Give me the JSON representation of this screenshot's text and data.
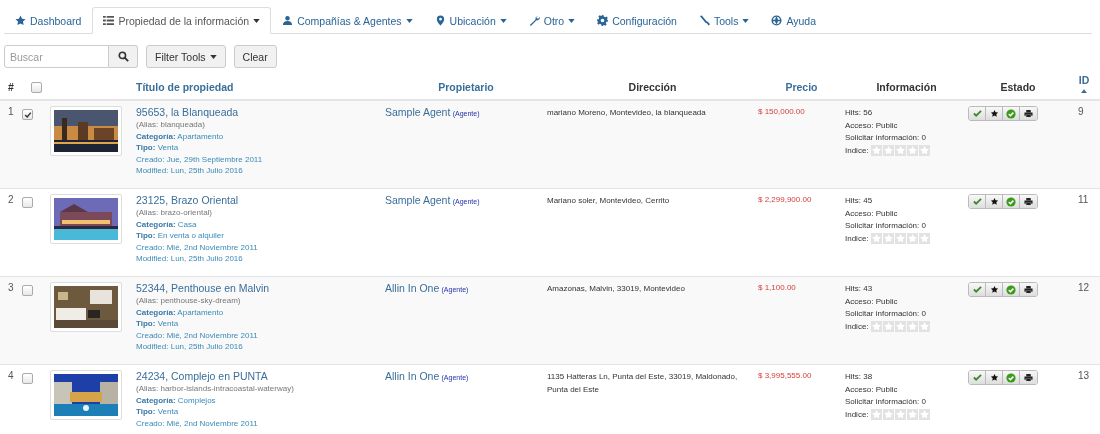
{
  "tabs": [
    {
      "label": "Dashboard",
      "dropdown": false,
      "selected": false
    },
    {
      "label": "Propiedad de la información",
      "dropdown": true,
      "selected": true
    },
    {
      "label": "Compañías & Agentes",
      "dropdown": true,
      "selected": false
    },
    {
      "label": "Ubicación",
      "dropdown": true,
      "selected": false
    },
    {
      "label": "Otro",
      "dropdown": true,
      "selected": false
    },
    {
      "label": "Configuración",
      "dropdown": false,
      "selected": false
    },
    {
      "label": "Tools",
      "dropdown": true,
      "selected": false
    },
    {
      "label": "Ayuda",
      "dropdown": false,
      "selected": false
    }
  ],
  "search": {
    "placeholder": "Buscar"
  },
  "toolbar": {
    "filter": "Filter Tools",
    "clear": "Clear"
  },
  "table": {
    "select_all": {
      "checked": false
    },
    "columns": [
      {
        "label": "#",
        "sortable": false,
        "sorted": false
      },
      {
        "label": "Título de propiedad",
        "sortable": true,
        "sorted": false
      },
      {
        "label": "Propietario",
        "sortable": true,
        "sorted": false
      },
      {
        "label": "Dirección",
        "sortable": false,
        "sorted": false
      },
      {
        "label": "Precio",
        "sortable": true,
        "sorted": false
      },
      {
        "label": "Información",
        "sortable": false,
        "sorted": false
      },
      {
        "label": "Estado",
        "sortable": false,
        "sorted": false
      },
      {
        "label": "ID",
        "sortable": true,
        "sorted": true
      }
    ],
    "rows": [
      {
        "num": "1",
        "checked": true,
        "title": "95653, la Blanqueada",
        "alias": "(Alias: blanqueada)",
        "category": "**Categoría:** Apartamento",
        "type": "**Tipo:** Venta",
        "created": "Creado: Jue, 29th Septiembre 2011",
        "modified": "Modified: Lun, 25th Julio 2016",
        "owner": "Sample Agent",
        "owner_role": "(Agente)",
        "address": "mariano Moreno, Montevideo, la blanqueada",
        "price": "$ 150,000.00",
        "hits": "Hits: 56",
        "access": "Acceso: Public",
        "requests": "Solicitar información: 0",
        "index_label": "Indice:",
        "stars": 0,
        "id": "9"
      },
      {
        "num": "2",
        "checked": false,
        "title": "23125, Brazo Oriental",
        "alias": "(Alias: brazo-oriental)",
        "category": "**Categoría:** Casa",
        "type": "**Tipo:** En venta o alquiler",
        "created": "Creado: Mié, 2nd Noviembre 2011",
        "modified": "Modified: Lun, 25th Julio 2016",
        "owner": "Sample Agent",
        "owner_role": "(Agente)",
        "address": "Mariano soler, Montevideo, Cerrito",
        "price": "$ 2,299,900.00",
        "hits": "Hits: 45",
        "access": "Acceso: Public",
        "requests": "Solicitar información: 0",
        "index_label": "Indice:",
        "stars": 0,
        "id": "11"
      },
      {
        "num": "3",
        "checked": false,
        "title": "52344, Penthouse en Malvin",
        "alias": "(Alias: penthouse-sky-dream)",
        "category": "**Categoría:** Apartamento",
        "type": "**Tipo:** Venta",
        "created": "Creado: Mié, 2nd Noviembre 2011",
        "modified": "Modified: Lun, 25th Julio 2016",
        "owner": "Allin In One",
        "owner_role": "(Agente)",
        "address": "Amazonas, Malvin, 33019, Montevideo",
        "price": "$ 1,100.00",
        "hits": "Hits: 43",
        "access": "Acceso: Public",
        "requests": "Solicitar información: 0",
        "index_label": "Indice:",
        "stars": 0,
        "id": "12"
      },
      {
        "num": "4",
        "checked": false,
        "title": "24234, Complejo en PUNTA",
        "alias": "(Alias: harbor-islands-intracoastal-waterway)",
        "category": "**Categoría:** Complejos",
        "type": "**Tipo:** Venta",
        "created": "Creado: Mié, 2nd Noviembre 2011",
        "owner": "Allin In One",
        "owner_role": "(Agente)",
        "address": "1135 Hatteras Ln, Punta del Este, 33019, Maldonado, Punta del Este",
        "price": "$ 3,995,555.00",
        "hits": "Hits: 38",
        "access": "Acceso: Public",
        "requests": "Solicitar información: 0",
        "index_label": "Indice:",
        "stars": 0,
        "id": "13"
      }
    ]
  }
}
